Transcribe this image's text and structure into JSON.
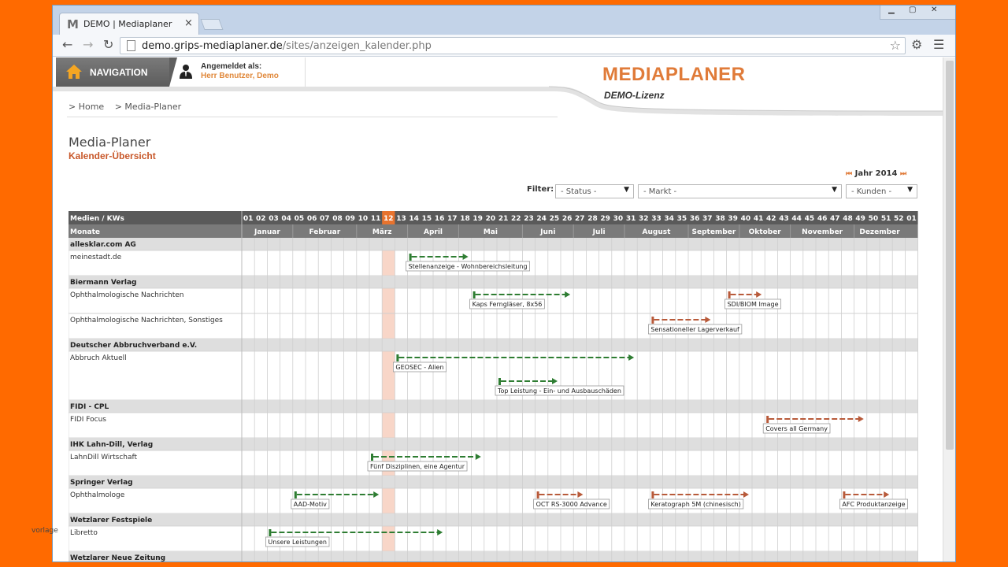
{
  "browser": {
    "tab_icon": "M",
    "tab_title": "DEMO | Mediaplaner",
    "url_host": "demo.grips-mediaplaner.de",
    "url_path": "/sites/anzeigen_kalender.php"
  },
  "header": {
    "nav_label": "NAVIGATION",
    "user_line1": "Angemeldet als:",
    "user_line2": "Herr Benutzer, Demo",
    "brand": "MEDIAPLANER",
    "license": "DEMO-Lizenz"
  },
  "breadcrumbs": [
    "> Home",
    "> Media-Planer"
  ],
  "page": {
    "title": "Media-Planer",
    "subtitle": "Kalender-Übersicht",
    "year_label": "Jahr",
    "year": "2014",
    "filter_label": "Filter:",
    "filters": [
      "- Status -",
      "- Markt -",
      "- Kunden -"
    ]
  },
  "calendar": {
    "head_kw": "Medien / KWs",
    "head_months": "Monate",
    "kws": [
      "01",
      "02",
      "03",
      "04",
      "05",
      "06",
      "07",
      "08",
      "09",
      "10",
      "11",
      "12",
      "13",
      "14",
      "15",
      "16",
      "17",
      "18",
      "19",
      "20",
      "21",
      "22",
      "23",
      "24",
      "25",
      "26",
      "27",
      "28",
      "29",
      "30",
      "31",
      "32",
      "33",
      "34",
      "35",
      "36",
      "37",
      "38",
      "39",
      "40",
      "41",
      "42",
      "43",
      "44",
      "45",
      "46",
      "47",
      "48",
      "49",
      "50",
      "51",
      "52",
      "01"
    ],
    "current_kw_index": 11,
    "months": [
      {
        "name": "Januar",
        "start": 0,
        "span": 4
      },
      {
        "name": "Februar",
        "start": 4,
        "span": 5
      },
      {
        "name": "März",
        "start": 9,
        "span": 4
      },
      {
        "name": "April",
        "start": 13,
        "span": 4
      },
      {
        "name": "Mai",
        "start": 17,
        "span": 5
      },
      {
        "name": "Juni",
        "start": 22,
        "span": 4
      },
      {
        "name": "Juli",
        "start": 26,
        "span": 4
      },
      {
        "name": "August",
        "start": 30,
        "span": 5
      },
      {
        "name": "September",
        "start": 35,
        "span": 4
      },
      {
        "name": "Oktober",
        "start": 39,
        "span": 4
      },
      {
        "name": "November",
        "start": 43,
        "span": 5
      },
      {
        "name": "Dezember",
        "start": 48,
        "span": 4
      }
    ],
    "groups": [
      {
        "name": "allesklar.com AG",
        "media": [
          {
            "name": "meinestadt.de",
            "lanes": 1,
            "bars": [
              {
                "label": "Stellenanzeige - Wohnbereichsleitung",
                "start": 13,
                "end": 17,
                "lane": 0,
                "color": "#2e7d32"
              }
            ]
          }
        ]
      },
      {
        "name": "Biermann Verlag",
        "media": [
          {
            "name": "Ophthalmologische Nachrichten",
            "lanes": 1,
            "bars": [
              {
                "label": "Kaps Ferngläser, 8x56",
                "start": 18,
                "end": 25,
                "lane": 0,
                "color": "#2e7d32"
              },
              {
                "label": "SDI/BIOM Image",
                "start": 38,
                "end": 40,
                "lane": 0,
                "color": "#b85a3a"
              }
            ]
          },
          {
            "name": "Ophthalmologische Nachrichten, Sonstiges",
            "lanes": 1,
            "bars": [
              {
                "label": "Sensationeller Lagerverkauf",
                "start": 32,
                "end": 36,
                "lane": 0,
                "color": "#b85a3a"
              }
            ]
          }
        ]
      },
      {
        "name": "Deutscher Abbruchverband e.V.",
        "media": [
          {
            "name": "Abbruch Aktuell",
            "lanes": 2,
            "bars": [
              {
                "label": "GEOSEC - Alien",
                "start": 12,
                "end": 30,
                "lane": 0,
                "color": "#2e7d32"
              },
              {
                "label": "Top Leistung - Ein- und Ausbauschäden",
                "start": 20,
                "end": 24,
                "lane": 1,
                "color": "#2e7d32"
              }
            ]
          }
        ]
      },
      {
        "name": "FIDI - CPL",
        "media": [
          {
            "name": "FIDI Focus",
            "lanes": 1,
            "bars": [
              {
                "label": "Covers all Germany",
                "start": 41,
                "end": 48,
                "lane": 0,
                "color": "#b85a3a"
              }
            ]
          }
        ]
      },
      {
        "name": "IHK Lahn-Dill, Verlag",
        "media": [
          {
            "name": "LahnDill Wirtschaft",
            "lanes": 1,
            "bars": [
              {
                "label": "Fünf Disziplinen, eine Agentur",
                "start": 10,
                "end": 18,
                "lane": 0,
                "color": "#2e7d32"
              }
            ]
          }
        ]
      },
      {
        "name": "Springer Verlag",
        "media": [
          {
            "name": "Ophthalmologe",
            "lanes": 1,
            "bars": [
              {
                "label": "AAD-Motiv",
                "start": 4,
                "end": 10,
                "lane": 0,
                "color": "#2e7d32"
              },
              {
                "label": "OCT RS-3000 Advance",
                "start": 23,
                "end": 26,
                "lane": 0,
                "color": "#b85a3a"
              },
              {
                "label": "Keratograph 5M (chinesisch)",
                "start": 32,
                "end": 39,
                "lane": 0,
                "color": "#b85a3a"
              },
              {
                "label": "AFC Produktanzeige",
                "start": 47,
                "end": 50,
                "lane": 0,
                "color": "#b85a3a"
              }
            ]
          }
        ]
      },
      {
        "name": "Wetzlarer Festspiele",
        "media": [
          {
            "name": "Libretto",
            "lanes": 1,
            "bars": [
              {
                "label": "Unsere Leistungen",
                "start": 2,
                "end": 15,
                "lane": 0,
                "color": "#2e7d32"
              }
            ]
          }
        ]
      },
      {
        "name": "Wetzlarer Neue Zeitung",
        "media": []
      }
    ]
  },
  "footer_text": "vorlage",
  "icons": [
    "home-icon",
    "user-icon",
    "back-icon",
    "forward-icon",
    "reload-icon",
    "star-icon",
    "gear-icon",
    "menu-icon"
  ]
}
